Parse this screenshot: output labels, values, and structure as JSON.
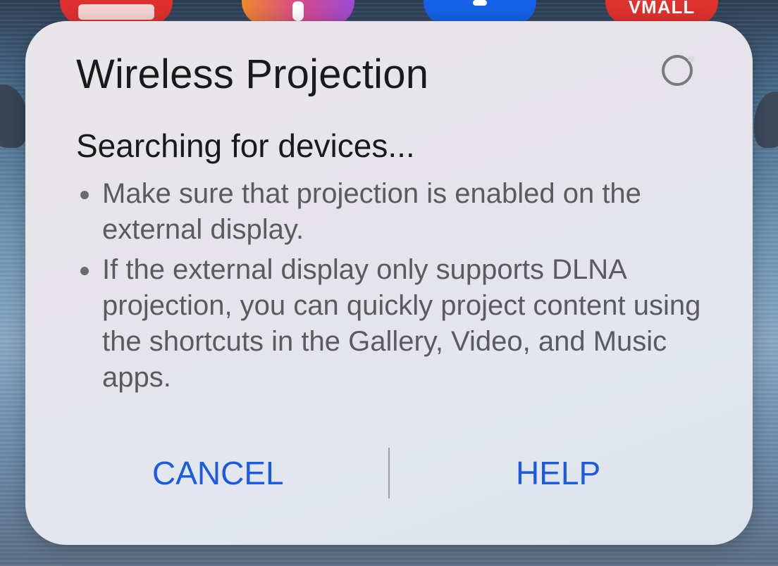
{
  "home_screen": {
    "apps": [
      {
        "name": "books-app-icon"
      },
      {
        "name": "themes-app-icon"
      },
      {
        "name": "blue-app-icon"
      },
      {
        "name": "vmall-app-icon",
        "label": "VMALL"
      }
    ]
  },
  "dialog": {
    "title": "Wireless Projection",
    "status": "Searching for devices...",
    "tips": [
      "Make sure that projection is enabled on the external display.",
      "If the external display only supports DLNA projection, you can quickly project content using the shortcuts in the Gallery, Video, and Music apps."
    ],
    "buttons": {
      "cancel": "CANCEL",
      "help": "HELP"
    },
    "accent_color": "#1a5be0",
    "spinner_icon": "loading-spinner-icon"
  }
}
